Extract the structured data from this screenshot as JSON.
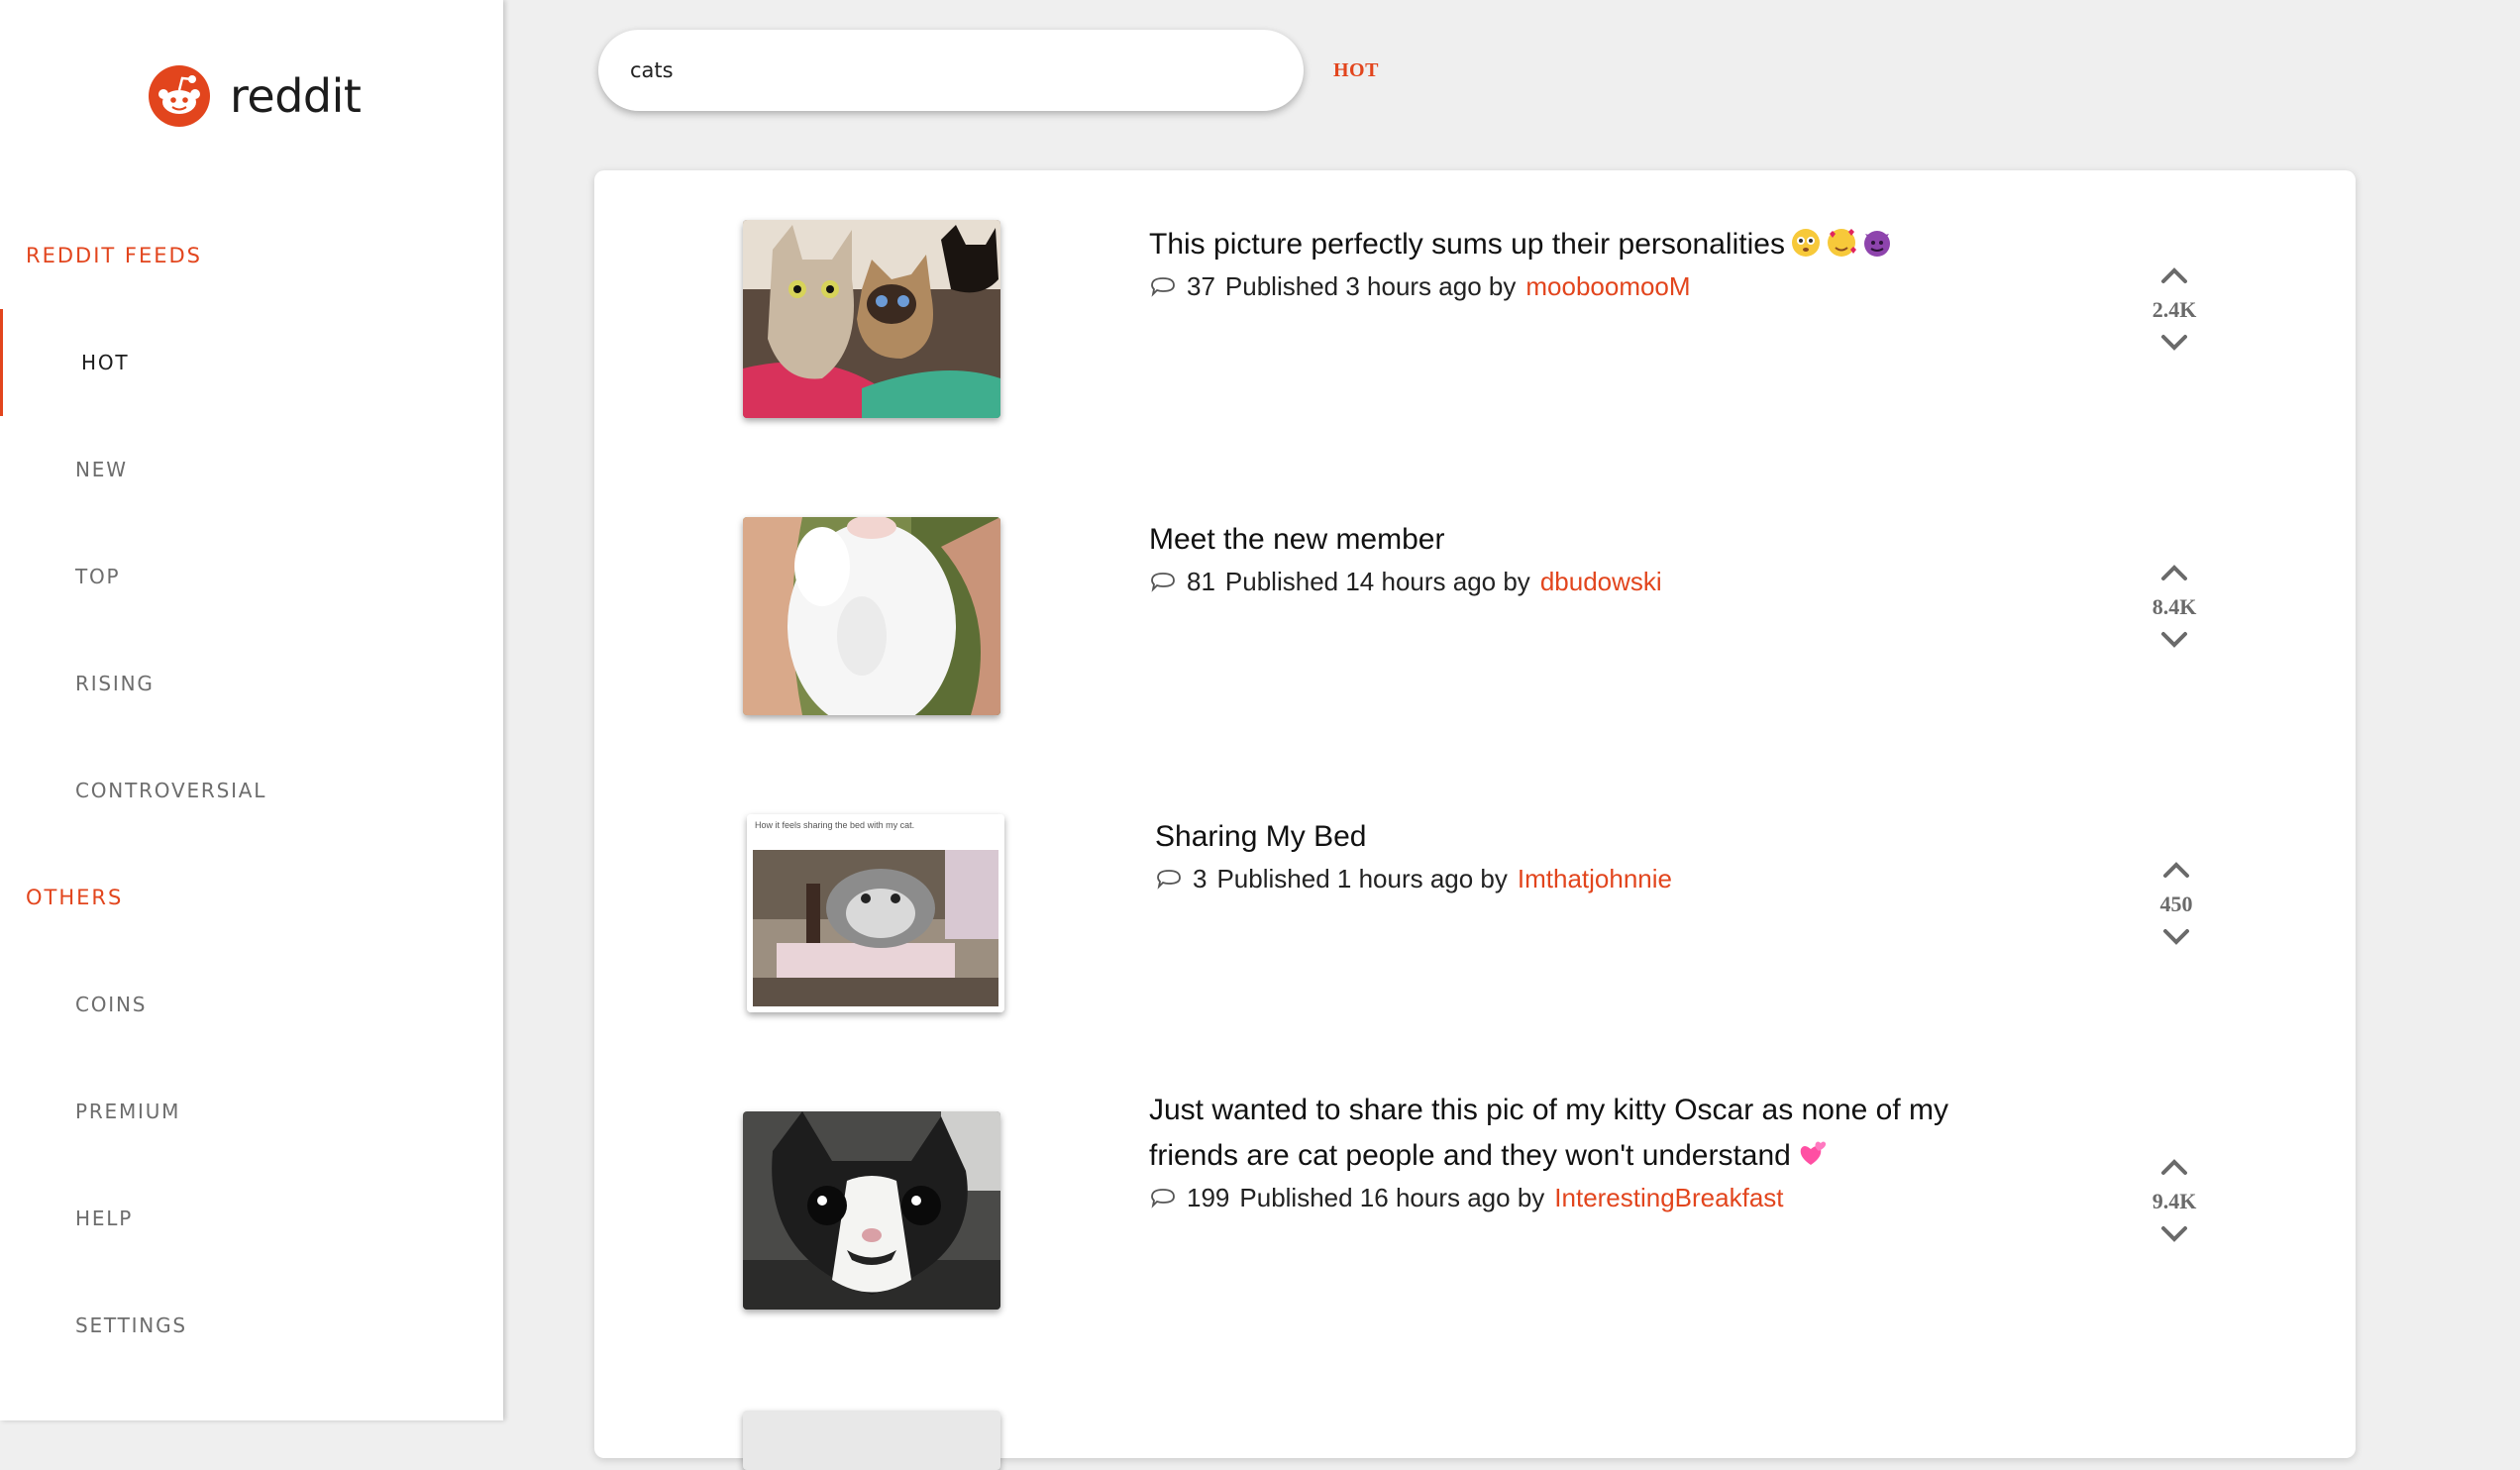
{
  "brand": {
    "name": "reddit",
    "accent": "#e2451d"
  },
  "sidebar": {
    "feeds_title": "REDDIT FEEDS",
    "feeds": [
      {
        "label": "HOT",
        "active": true
      },
      {
        "label": "NEW"
      },
      {
        "label": "TOP"
      },
      {
        "label": "RISING"
      },
      {
        "label": "CONTROVERSIAL"
      }
    ],
    "others_title": "OTHERS",
    "others": [
      {
        "label": "COINS"
      },
      {
        "label": "PREMIUM"
      },
      {
        "label": "HELP"
      },
      {
        "label": "SETTINGS"
      }
    ]
  },
  "search": {
    "value": "cats",
    "current_feed": "HOT"
  },
  "posts": [
    {
      "title": "This picture perfectly sums up their personalities",
      "emojis": [
        "flushed-face",
        "smiling-face-with-hearts",
        "smiling-face-with-horns"
      ],
      "comments": "37",
      "published": "Published 3 hours ago by",
      "author": "mooboomooM",
      "score": "2.4K",
      "thumb": "three-cats-on-blanket"
    },
    {
      "title": "Meet the new member",
      "comments": "81",
      "published": "Published 14 hours ago by",
      "author": "dbudowski",
      "score": "8.4K",
      "thumb": "white-kitten-belly"
    },
    {
      "title": "Sharing My Bed",
      "comments": "3",
      "published": "Published 1 hours ago by",
      "author": "Imthatjohnnie",
      "score": "450",
      "thumb": "meme-cat-on-bed",
      "thumb_caption": "How it feels sharing the bed with my cat."
    },
    {
      "title": "Just wanted to share this pic of my kitty Oscar as none of my friends are cat people and they won't understand",
      "emojis": [
        "two-hearts"
      ],
      "comments": "199",
      "published": "Published 16 hours ago by",
      "author": "InterestingBreakfast",
      "score": "9.4K",
      "thumb": "tuxedo-cat-closeup"
    }
  ]
}
